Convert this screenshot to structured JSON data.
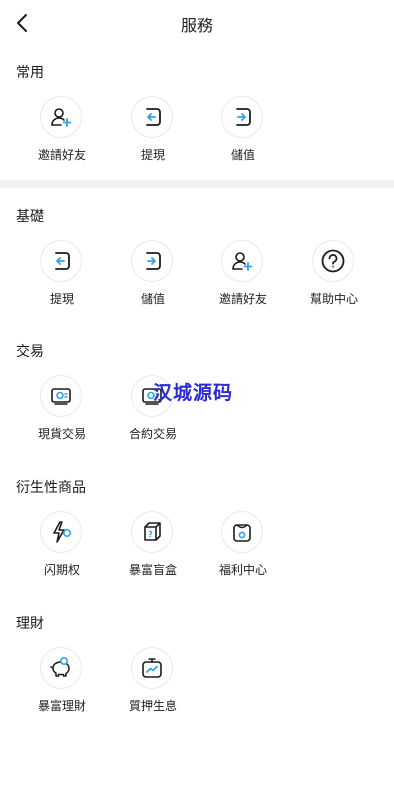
{
  "header": {
    "title": "服務"
  },
  "sections": [
    {
      "title": "常用",
      "items": [
        {
          "label": "邀請好友",
          "icon": "invite-user-icon"
        },
        {
          "label": "提現",
          "icon": "withdraw-icon"
        },
        {
          "label": "儲值",
          "icon": "deposit-icon"
        }
      ]
    },
    {
      "title": "基礎",
      "items": [
        {
          "label": "提現",
          "icon": "withdraw-icon"
        },
        {
          "label": "儲值",
          "icon": "deposit-icon"
        },
        {
          "label": "邀請好友",
          "icon": "invite-user-icon"
        },
        {
          "label": "幫助中心",
          "icon": "help-icon"
        }
      ]
    },
    {
      "title": "交易",
      "items": [
        {
          "label": "現貨交易",
          "icon": "spot-trade-icon"
        },
        {
          "label": "合約交易",
          "icon": "contract-trade-icon"
        }
      ]
    },
    {
      "title": "衍生性商品",
      "items": [
        {
          "label": "闪期权",
          "icon": "flash-option-icon"
        },
        {
          "label": "暴富盲盒",
          "icon": "mystery-box-icon"
        },
        {
          "label": "福利中心",
          "icon": "welfare-icon"
        }
      ]
    },
    {
      "title": "理財",
      "items": [
        {
          "label": "暴富理財",
          "icon": "piggy-bank-icon"
        },
        {
          "label": "質押生息",
          "icon": "staking-chart-icon"
        }
      ]
    }
  ],
  "watermark": "汉城源码",
  "colors": {
    "accent": "#2da3e8",
    "icon_dark": "#1c1c1c",
    "divider": "#f2f3f5",
    "watermark": "#2a2bd6"
  }
}
